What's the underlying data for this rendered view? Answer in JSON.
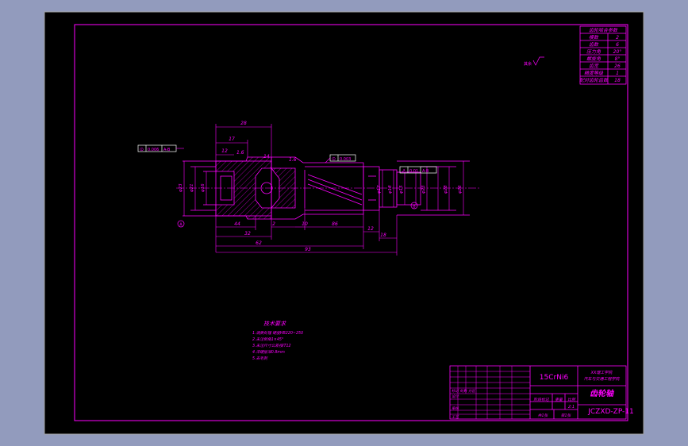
{
  "colors": {
    "viewport_bg": "#929bbd",
    "paper": "#000000",
    "line": "#ff00ff",
    "annotation": "#ffffff"
  },
  "params_table": {
    "header": "齿轮啮合参数",
    "rows": [
      {
        "name": "模数",
        "value": "2"
      },
      {
        "name": "齿数",
        "value": "6"
      },
      {
        "name": "压力角",
        "value": "20°"
      },
      {
        "name": "螺旋角",
        "value": "8°"
      },
      {
        "name": "齿宽",
        "value": "26"
      },
      {
        "name": "精度等级",
        "value": "1"
      },
      {
        "name": "配对齿轮齿数",
        "value": "18"
      }
    ]
  },
  "roughness_note": "其余",
  "dimensions": {
    "top_dims": [
      "28",
      "17",
      "12",
      "14",
      "1.6",
      "1.6"
    ],
    "bottom_dims": [
      "44",
      "32",
      "62",
      "2",
      "10",
      "86",
      "12",
      "18",
      "93"
    ],
    "left_diameters": [
      "φ23",
      "φ21",
      "φ16"
    ],
    "right_diameters": [
      "φ17",
      "φ18",
      "φ15",
      "φ23",
      "φ28",
      "φ26"
    ],
    "left_tolerance": {
      "symbol": "⊙",
      "value": "0.006",
      "datum": "A-B"
    },
    "mid_tolerance": {
      "symbol": "⊙",
      "value": "0.003"
    },
    "right_tolerance": {
      "symbol": "↗",
      "value": "0.01",
      "datum": "A-B"
    },
    "datum_left": "A",
    "datum_right": "B"
  },
  "tech_requirements": {
    "title": "技术要求",
    "items": [
      "1.调质处理 硬度HB220~250",
      "2.未注倒角1×45°",
      "3.未注尺寸公差按IT12",
      "4.淬硬层深0.8mm",
      "5.去毛刺"
    ]
  },
  "title_block": {
    "material": "15CrNi6",
    "school": "XX理工学院",
    "school_sub": "汽车与交通工程学院",
    "drawing_name": "齿轮轴",
    "drawing_number": "JCZXD-ZP-11",
    "scale": "2:1",
    "row_labels": [
      "标记 处数 分区",
      "设计",
      "审核",
      "工艺"
    ],
    "stage_label": "阶段标记",
    "weight_label": "重量",
    "scale_label": "比例",
    "sheet_total": "共1张",
    "sheet_no": "第1张"
  }
}
